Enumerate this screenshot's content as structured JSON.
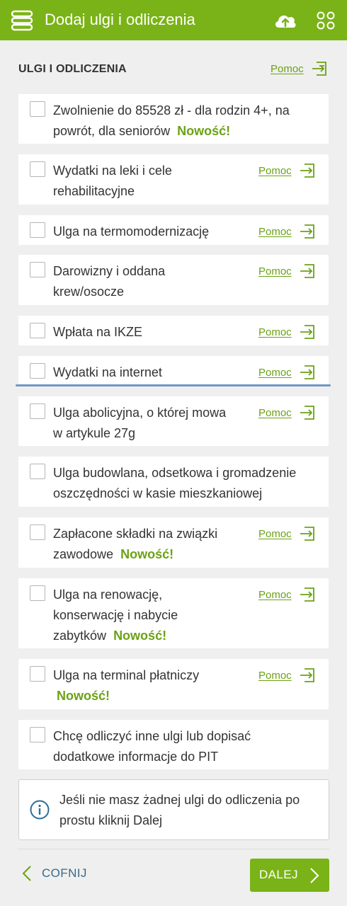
{
  "header": {
    "title": "Dodaj ulgi i odliczenia",
    "menu_icon": "menu-icon",
    "cloud_icon": "cloud-upload-icon",
    "grid_icon": "apps-grid-icon",
    "color": "#7ab317"
  },
  "section": {
    "title": "ULGI I ODLICZENIA",
    "help_label": "Pomoc"
  },
  "items": [
    {
      "label_l1": "Zwolnienie do 85528 zł - dla rodzin 4+, na",
      "label_l2": "powrót, dla seniorów",
      "badge": "Nowość!"
    },
    {
      "label_l1": "Wydatki na leki i cele",
      "label_l2": "rehabilitacyjne",
      "help": "Pomoc"
    },
    {
      "label_l1": "Ulga na termomodernizację",
      "help": "Pomoc"
    },
    {
      "label_l1": "Darowizny i oddana",
      "label_l2": "krew/osocze",
      "help": "Pomoc"
    },
    {
      "label_l1": "Wpłata na IKZE",
      "help": "Pomoc"
    },
    {
      "label_l1": "Wydatki na internet",
      "help": "Pomoc"
    },
    {
      "label_l1": "Ulga abolicyjna, o której mowa",
      "label_l2": "w artykule 27g",
      "help": "Pomoc"
    },
    {
      "label_l1": "Ulga budowlana, odsetkowa i gromadzenie",
      "label_l2": "oszczędności w kasie mieszkaniowej"
    },
    {
      "label_l1": "Zapłacone składki na związki",
      "label_l2": "zawodowe",
      "badge": "Nowość!",
      "help": "Pomoc"
    },
    {
      "label_l1": "Ulga na renowację,",
      "label_l2": "konserwację i nabycie",
      "label_l3": "zabytków",
      "badge": "Nowość!",
      "help": "Pomoc"
    },
    {
      "label_l1": "Ulga na terminal płatniczy",
      "badge": "Nowość!",
      "help": "Pomoc"
    },
    {
      "label_l1": "Chcę odliczyć inne ulgi lub dopisać",
      "label_l2": "dodatkowe informacje do PIT"
    }
  ],
  "info": {
    "line1": "Jeśli nie masz żadnej ulgi do odliczenia po",
    "line2": "prostu kliknij Dalej",
    "icon": "info-icon"
  },
  "footer": {
    "back_label": "COFNIJ",
    "next_label": "DALEJ"
  }
}
